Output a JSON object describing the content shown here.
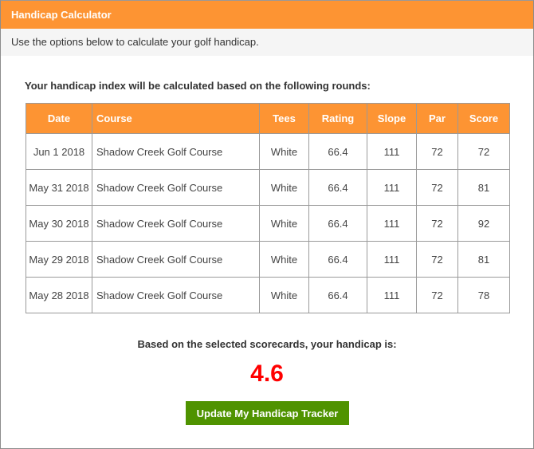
{
  "header": {
    "title": "Handicap Calculator"
  },
  "subheader": {
    "text": "Use the options below to calculate your golf handicap."
  },
  "intro": "Your handicap index will be calculated based on the following rounds:",
  "table": {
    "columns": [
      "Date",
      "Course",
      "Tees",
      "Rating",
      "Slope",
      "Par",
      "Score"
    ],
    "rows": [
      [
        "Jun 1 2018",
        "Shadow Creek Golf Course",
        "White",
        "66.4",
        "111",
        "72",
        "72"
      ],
      [
        "May 31 2018",
        "Shadow Creek Golf Course",
        "White",
        "66.4",
        "111",
        "72",
        "81"
      ],
      [
        "May 30 2018",
        "Shadow Creek Golf Course",
        "White",
        "66.4",
        "111",
        "72",
        "92"
      ],
      [
        "May 29 2018",
        "Shadow Creek Golf Course",
        "White",
        "66.4",
        "111",
        "72",
        "81"
      ],
      [
        "May 28 2018",
        "Shadow Creek Golf Course",
        "White",
        "66.4",
        "111",
        "72",
        "78"
      ]
    ]
  },
  "result": {
    "label": "Based on the selected scorecards, your handicap is:",
    "value": "4.6"
  },
  "actions": {
    "update_label": "Update My Handicap Tracker"
  },
  "colors": {
    "accent": "#fd9433",
    "button": "#4f9300",
    "result": "#ff0000"
  }
}
